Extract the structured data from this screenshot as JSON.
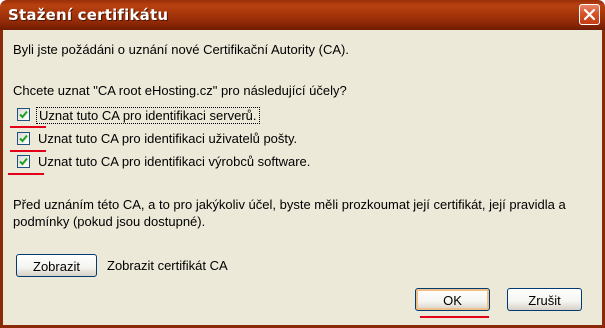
{
  "window": {
    "title": "Stažení certifikátu"
  },
  "dialog": {
    "intro": "Byli jste požádáni o uznání nové Certifikační Autority (CA).",
    "question": "Chcete uznat \"CA root eHosting.cz\" pro následující účely?",
    "options": [
      {
        "label": "Uznat tuto CA pro identifikaci serverů.",
        "checked": true
      },
      {
        "label": "Uznat tuto CA pro identifikaci uživatelů pošty.",
        "checked": true
      },
      {
        "label": "Uznat tuto CA pro identifikaci výrobců software.",
        "checked": true
      }
    ],
    "advice_line1": "Před uznáním této CA, a to pro jakýkoliv účel, byste měli prozkoumat její certifikát, její pravidla a",
    "advice_line2": "podmínky (pokud jsou dostupné).",
    "view_button": "Zobrazit",
    "view_label": "Zobrazit certifikát CA"
  },
  "buttons": {
    "ok": "OK",
    "cancel": "Zrušit"
  },
  "colors": {
    "titlebar": "#a8360b",
    "client": "#ece9d8",
    "annotation": "#e3001b"
  },
  "icons": {
    "close": "close-icon",
    "check": "checkmark-icon"
  }
}
